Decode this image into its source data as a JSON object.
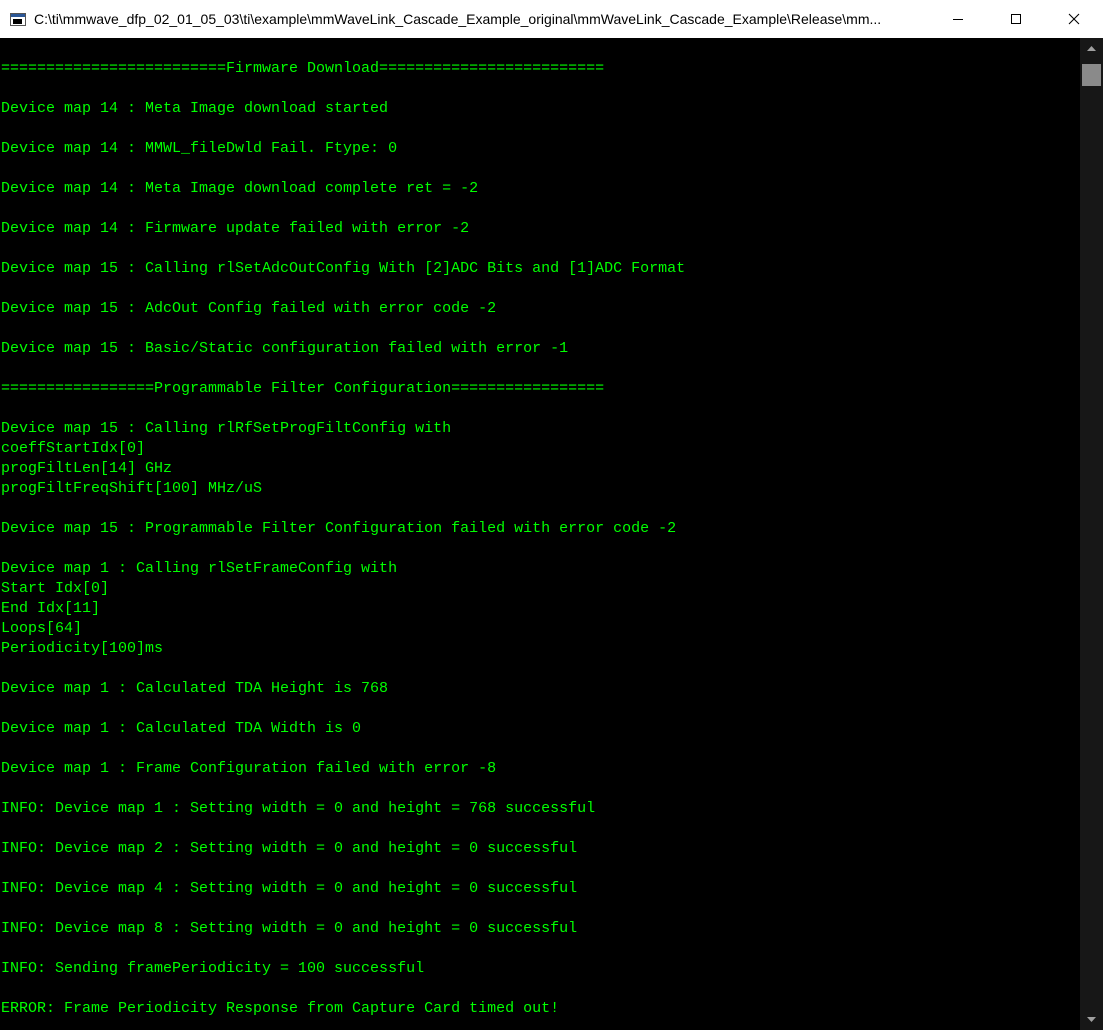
{
  "window": {
    "title": "C:\\ti\\mmwave_dfp_02_01_05_03\\ti\\example\\mmWaveLink_Cascade_Example_original\\mmWaveLink_Cascade_Example\\Release\\mm...",
    "controls": {
      "minimize": "minimize-icon",
      "maximize": "maximize-icon",
      "close": "close-icon"
    }
  },
  "console": {
    "text_color": "#00ff00",
    "background": "#000000",
    "lines": [
      "=========================Firmware Download=========================",
      "",
      "Device map 14 : Meta Image download started",
      "",
      "Device map 14 : MMWL_fileDwld Fail. Ftype: 0",
      "",
      "Device map 14 : Meta Image download complete ret = -2",
      "",
      "Device map 14 : Firmware update failed with error -2",
      "",
      "Device map 15 : Calling rlSetAdcOutConfig With [2]ADC Bits and [1]ADC Format",
      "",
      "Device map 15 : AdcOut Config failed with error code -2",
      "",
      "Device map 15 : Basic/Static configuration failed with error -1",
      "",
      "=================Programmable Filter Configuration=================",
      "",
      "Device map 15 : Calling rlRfSetProgFiltConfig with",
      "coeffStartIdx[0]",
      "progFiltLen[14] GHz",
      "progFiltFreqShift[100] MHz/uS",
      "",
      "Device map 15 : Programmable Filter Configuration failed with error code -2",
      "",
      "Device map 1 : Calling rlSetFrameConfig with",
      "Start Idx[0]",
      "End Idx[11]",
      "Loops[64]",
      "Periodicity[100]ms",
      "",
      "Device map 1 : Calculated TDA Height is 768",
      "",
      "Device map 1 : Calculated TDA Width is 0",
      "",
      "Device map 1 : Frame Configuration failed with error -8",
      "",
      "INFO: Device map 1 : Setting width = 0 and height = 768 successful",
      "",
      "INFO: Device map 2 : Setting width = 0 and height = 0 successful",
      "",
      "INFO: Device map 4 : Setting width = 0 and height = 0 successful",
      "",
      "INFO: Device map 8 : Setting width = 0 and height = 0 successful",
      "",
      "INFO: Sending framePeriodicity = 100 successful",
      "",
      "ERROR: Frame Periodicity Response from Capture Card timed out!"
    ]
  },
  "scrollbar": {
    "up_icon": "scroll-up-arrow-icon",
    "down_icon": "scroll-down-arrow-icon"
  }
}
